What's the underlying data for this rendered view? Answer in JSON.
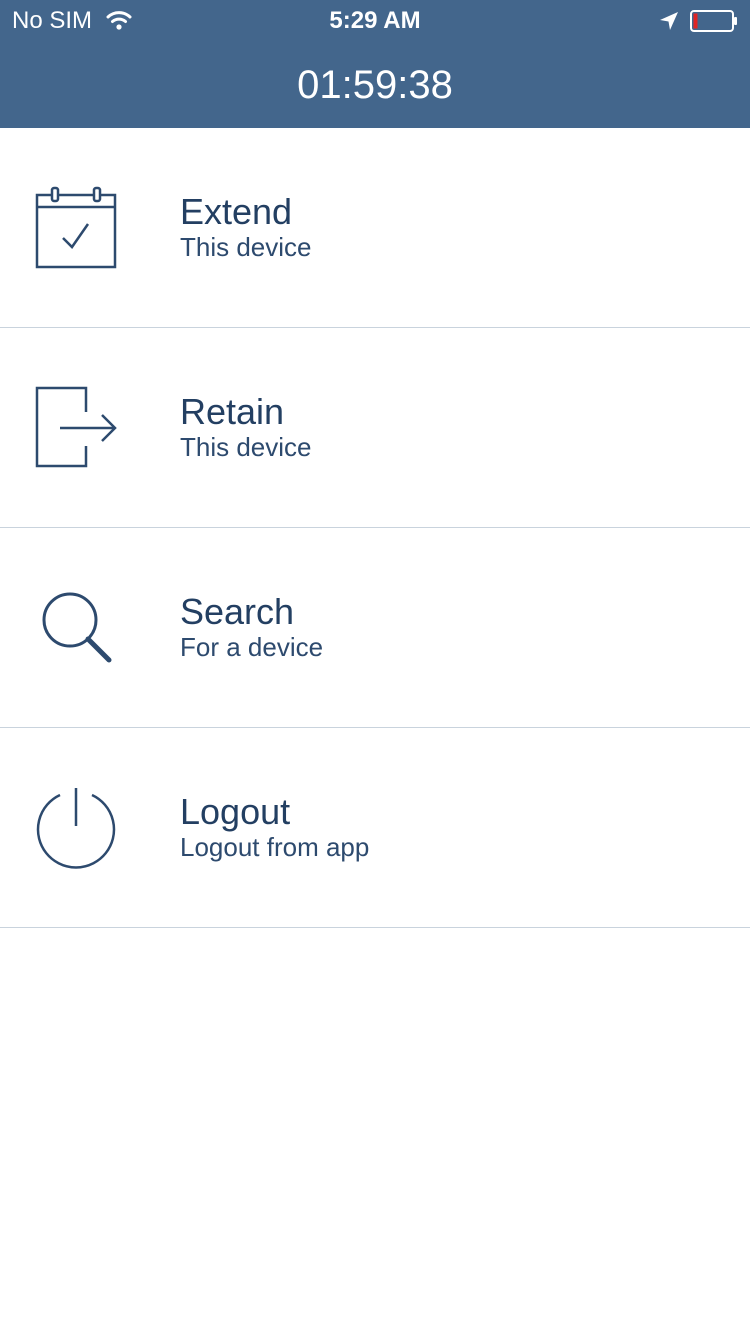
{
  "status_bar": {
    "carrier": "No SIM",
    "time": "5:29 AM",
    "icons": [
      "wifi-icon",
      "location-arrow-icon",
      "battery-icon"
    ]
  },
  "header": {
    "timer": "01:59:38",
    "background_color": "#43668c"
  },
  "menu": {
    "items": [
      {
        "title": "Extend",
        "subtitle": "This device",
        "icon": "calendar-check-icon"
      },
      {
        "title": "Retain",
        "subtitle": "This device",
        "icon": "exit-arrow-icon"
      },
      {
        "title": "Search",
        "subtitle": "For a device",
        "icon": "search-icon"
      },
      {
        "title": "Logout",
        "subtitle": "Logout from app",
        "icon": "power-icon"
      }
    ]
  },
  "colors": {
    "text_primary": "#233f62",
    "divider": "#c9d3dd",
    "battery_low": "#e02424"
  }
}
